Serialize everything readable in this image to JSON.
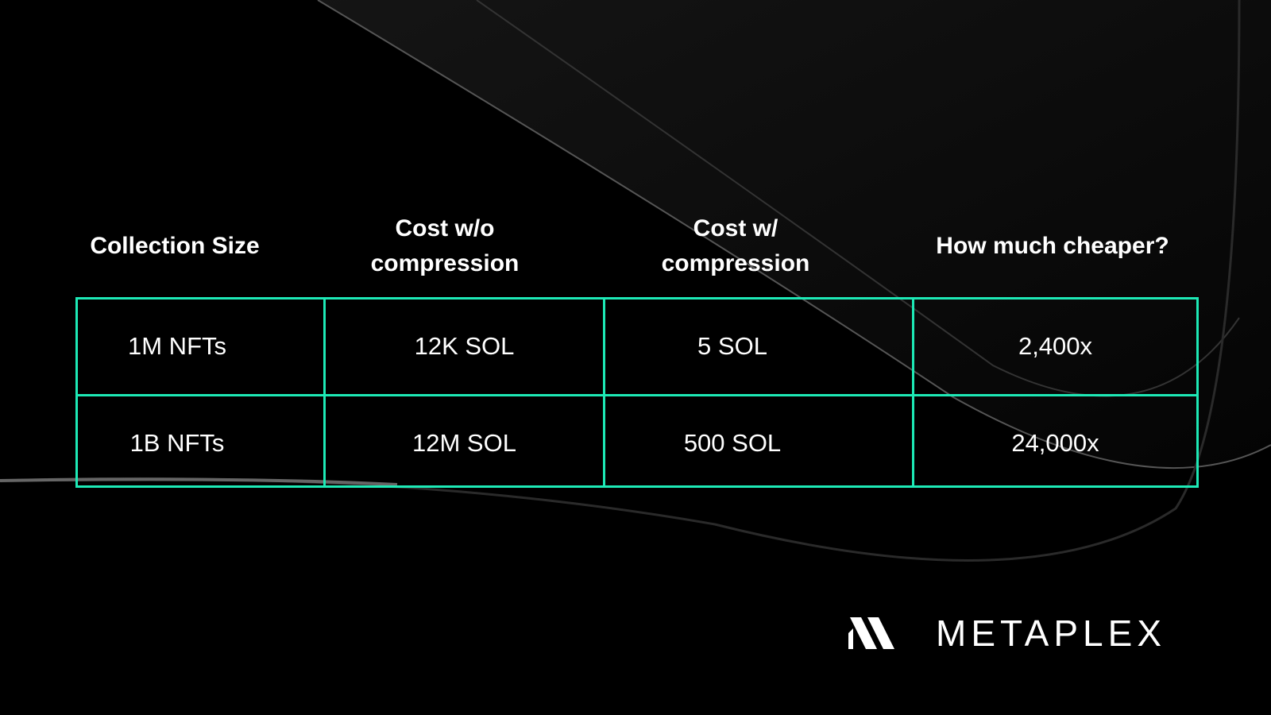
{
  "table": {
    "headers": [
      "Collection Size",
      "Cost w/o compression",
      "Cost w/ compression",
      "How much cheaper?"
    ],
    "headers_lines": [
      [
        "Collection Size"
      ],
      [
        "Cost w/o",
        "compression"
      ],
      [
        "Cost w/",
        "compression"
      ],
      [
        "How much cheaper?"
      ]
    ],
    "rows": [
      [
        "1M NFTs",
        "12K SOL",
        "5 SOL",
        "2,400x"
      ],
      [
        "1B NFTs",
        "12M SOL",
        "500 SOL",
        "24,000x"
      ]
    ]
  },
  "brand": {
    "name": "METAPLEX",
    "logo_icon": "metaplex-logo-icon"
  },
  "colors": {
    "accent": "#1de9b6",
    "background": "#000000",
    "text": "#ffffff"
  }
}
